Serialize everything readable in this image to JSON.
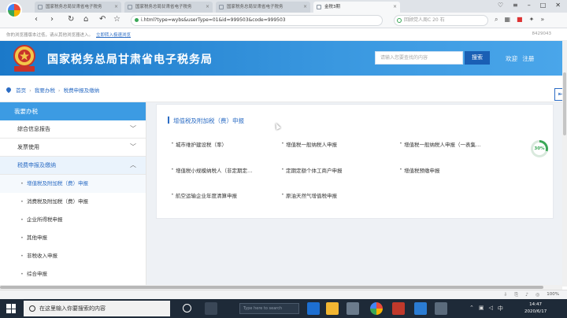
{
  "browser": {
    "tabs": [
      {
        "label": "国家税务总局甘肃省电子税务"
      },
      {
        "label": "国家税务总局甘肃省电子税务"
      },
      {
        "label": "国家税务总局甘肃省电子税务"
      },
      {
        "label": "金税3期"
      }
    ],
    "url": "i.html?type=wybs&userType=01&id=999503&code=999503",
    "search_placeholder": "回顾党人周C 20 石"
  },
  "infobar": {
    "message": "你的浏览器版本过低，请从其他浏览器进入。",
    "link": "立即转入极速浏览",
    "right_text": "8429043"
  },
  "site": {
    "title": "国家税务总局甘肃省电子税务局",
    "search_placeholder": "请输入您要查找的内容",
    "search_button": "搜索",
    "welcome": "欢迎",
    "logout": "注册",
    "emblem_text": "甘肃税务"
  },
  "breadcrumb": {
    "home": "首页",
    "level1": "我要办税",
    "level2": "税费申报及缴纳"
  },
  "sidebar": {
    "header": "我要办税",
    "items": [
      {
        "label": "综合信息报告",
        "chevron": "﹀"
      },
      {
        "label": "发票使用",
        "chevron": "﹀"
      },
      {
        "label": "税费申报及缴纳",
        "chevron": "︿"
      }
    ],
    "subitems": [
      {
        "label": "增值税及附加税（费）申报"
      },
      {
        "label": "消费税及附加税（费）申报"
      },
      {
        "label": "企业所得税申报"
      },
      {
        "label": "其他申报"
      },
      {
        "label": "非税收入申报"
      },
      {
        "label": "综合申报"
      }
    ]
  },
  "panel": {
    "title": "增值税及附加税（费）申报",
    "items": [
      {
        "label": "城市维护建设税（率）"
      },
      {
        "label": "增值税一般纳税人申报"
      },
      {
        "label": "增值税一般纳税人申报（一表集…"
      },
      {
        "label": "增值税小规模纳税人（非定期定…"
      },
      {
        "label": "定期定额个体工商户申报"
      },
      {
        "label": "增值税预缴申报"
      },
      {
        "label": "航空运输企业年度清算申报"
      },
      {
        "label": "原油天然气增值税申报"
      }
    ]
  },
  "progress_widget": {
    "percent_label": "30%",
    "value": 0.3
  },
  "statusbar": {
    "zoom": "100%"
  },
  "taskbar": {
    "search_placeholder": "在这里输入你要搜索的内容",
    "search2": "Type here to search",
    "time": "14:47",
    "date": "2020/6/17",
    "ime": "中"
  },
  "colors": {
    "header_blue": "#1b79c9",
    "accent": "#2b6cc4",
    "sidebar_head": "#3c9be3"
  }
}
